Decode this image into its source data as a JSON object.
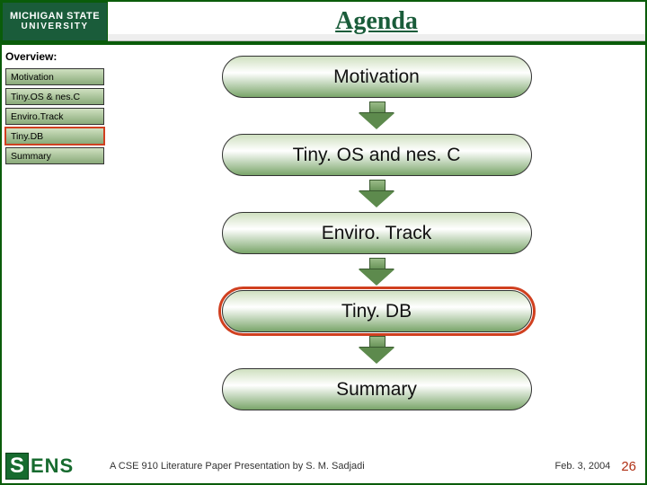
{
  "header": {
    "logo_line1": "MICHIGAN STATE",
    "logo_line2": "UNIVERSITY",
    "title": "Agenda"
  },
  "sidebar": {
    "title": "Overview:",
    "items": [
      {
        "label": "Motivation",
        "current": false
      },
      {
        "label": "Tiny.OS & nes.C",
        "current": false
      },
      {
        "label": "Enviro.Track",
        "current": false
      },
      {
        "label": "Tiny.DB",
        "current": true
      },
      {
        "label": "Summary",
        "current": false
      }
    ]
  },
  "flow": {
    "nodes": [
      {
        "label": "Motivation",
        "current": false
      },
      {
        "label": "Tiny. OS and nes. C",
        "current": false
      },
      {
        "label": "Enviro. Track",
        "current": false
      },
      {
        "label": "Tiny. DB",
        "current": true
      },
      {
        "label": "Summary",
        "current": false
      }
    ]
  },
  "footer": {
    "logo_s": "S",
    "logo_ens": "ENS",
    "text": "A CSE 910 Literature Paper Presentation by S. M. Sadjadi",
    "date": "Feb. 3, 2004",
    "page": "26"
  }
}
